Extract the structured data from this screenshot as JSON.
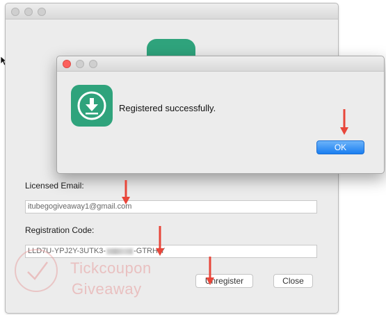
{
  "main_window": {
    "licensed_email_label": "Licensed Email:",
    "licensed_email_value": "itubegogiveaway1@gmail.com",
    "registration_code_label": "Registration Code:",
    "registration_code_prefix": "LLD7U-YPJ2Y-3UTK3-",
    "registration_code_suffix": "-GTRHIY",
    "unregister_button": "Unregister",
    "close_button": "Close"
  },
  "dialog": {
    "message": "Registered successfully.",
    "ok_button": "OK"
  },
  "watermark": {
    "line1": "Tickcoupon",
    "line2": "Giveaway"
  },
  "colors": {
    "app_icon": "#2fa37c",
    "annotation_arrow": "#e8463a",
    "ok_button": "#1a7ef0"
  }
}
